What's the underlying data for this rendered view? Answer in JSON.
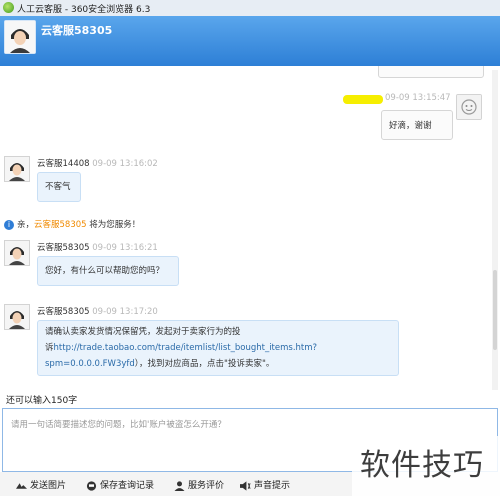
{
  "window": {
    "title": "人工云客服 - 360安全浏览器 6.3"
  },
  "header": {
    "name": "云客服58305"
  },
  "messages": {
    "m1": {
      "time": "09-09 13:15:47",
      "text": "好滴，谢谢"
    },
    "m2": {
      "sender": "云客服14408",
      "time": "09-09 13:16:02",
      "text": "不客气"
    },
    "system": {
      "prefix": "亲，",
      "agent": "云客服58305",
      "suffix": " 将为您服务！"
    },
    "m3": {
      "sender": "云客服58305",
      "time": "09-09 13:16:21",
      "text": "您好，有什么可以帮助您的吗？"
    },
    "m4": {
      "sender": "云客服58305",
      "time": "09-09 13:17:20",
      "line1": "请确认卖家发货情况保留凭，发起对于卖家行为的投",
      "line2_pre": "诉",
      "link1": "http://trade.taobao.com/trade/itemlist/list_bought_items.htm?",
      "link2": "spm=0.0.0.0.FW3yfd",
      "line3_post": "），找到对应商品，点击\"投诉卖家\"。"
    }
  },
  "counter": {
    "text": "还可以输入150字"
  },
  "input": {
    "placeholder": "请用一句话简要描述您的问题，比如'账户被盗怎么开通？"
  },
  "toolbar": {
    "send_image": "发送图片",
    "save_record": "保存查询记录",
    "rate_service": "服务评价",
    "sound_tip": "声音提示"
  },
  "watermark": {
    "text": "软件技巧"
  }
}
